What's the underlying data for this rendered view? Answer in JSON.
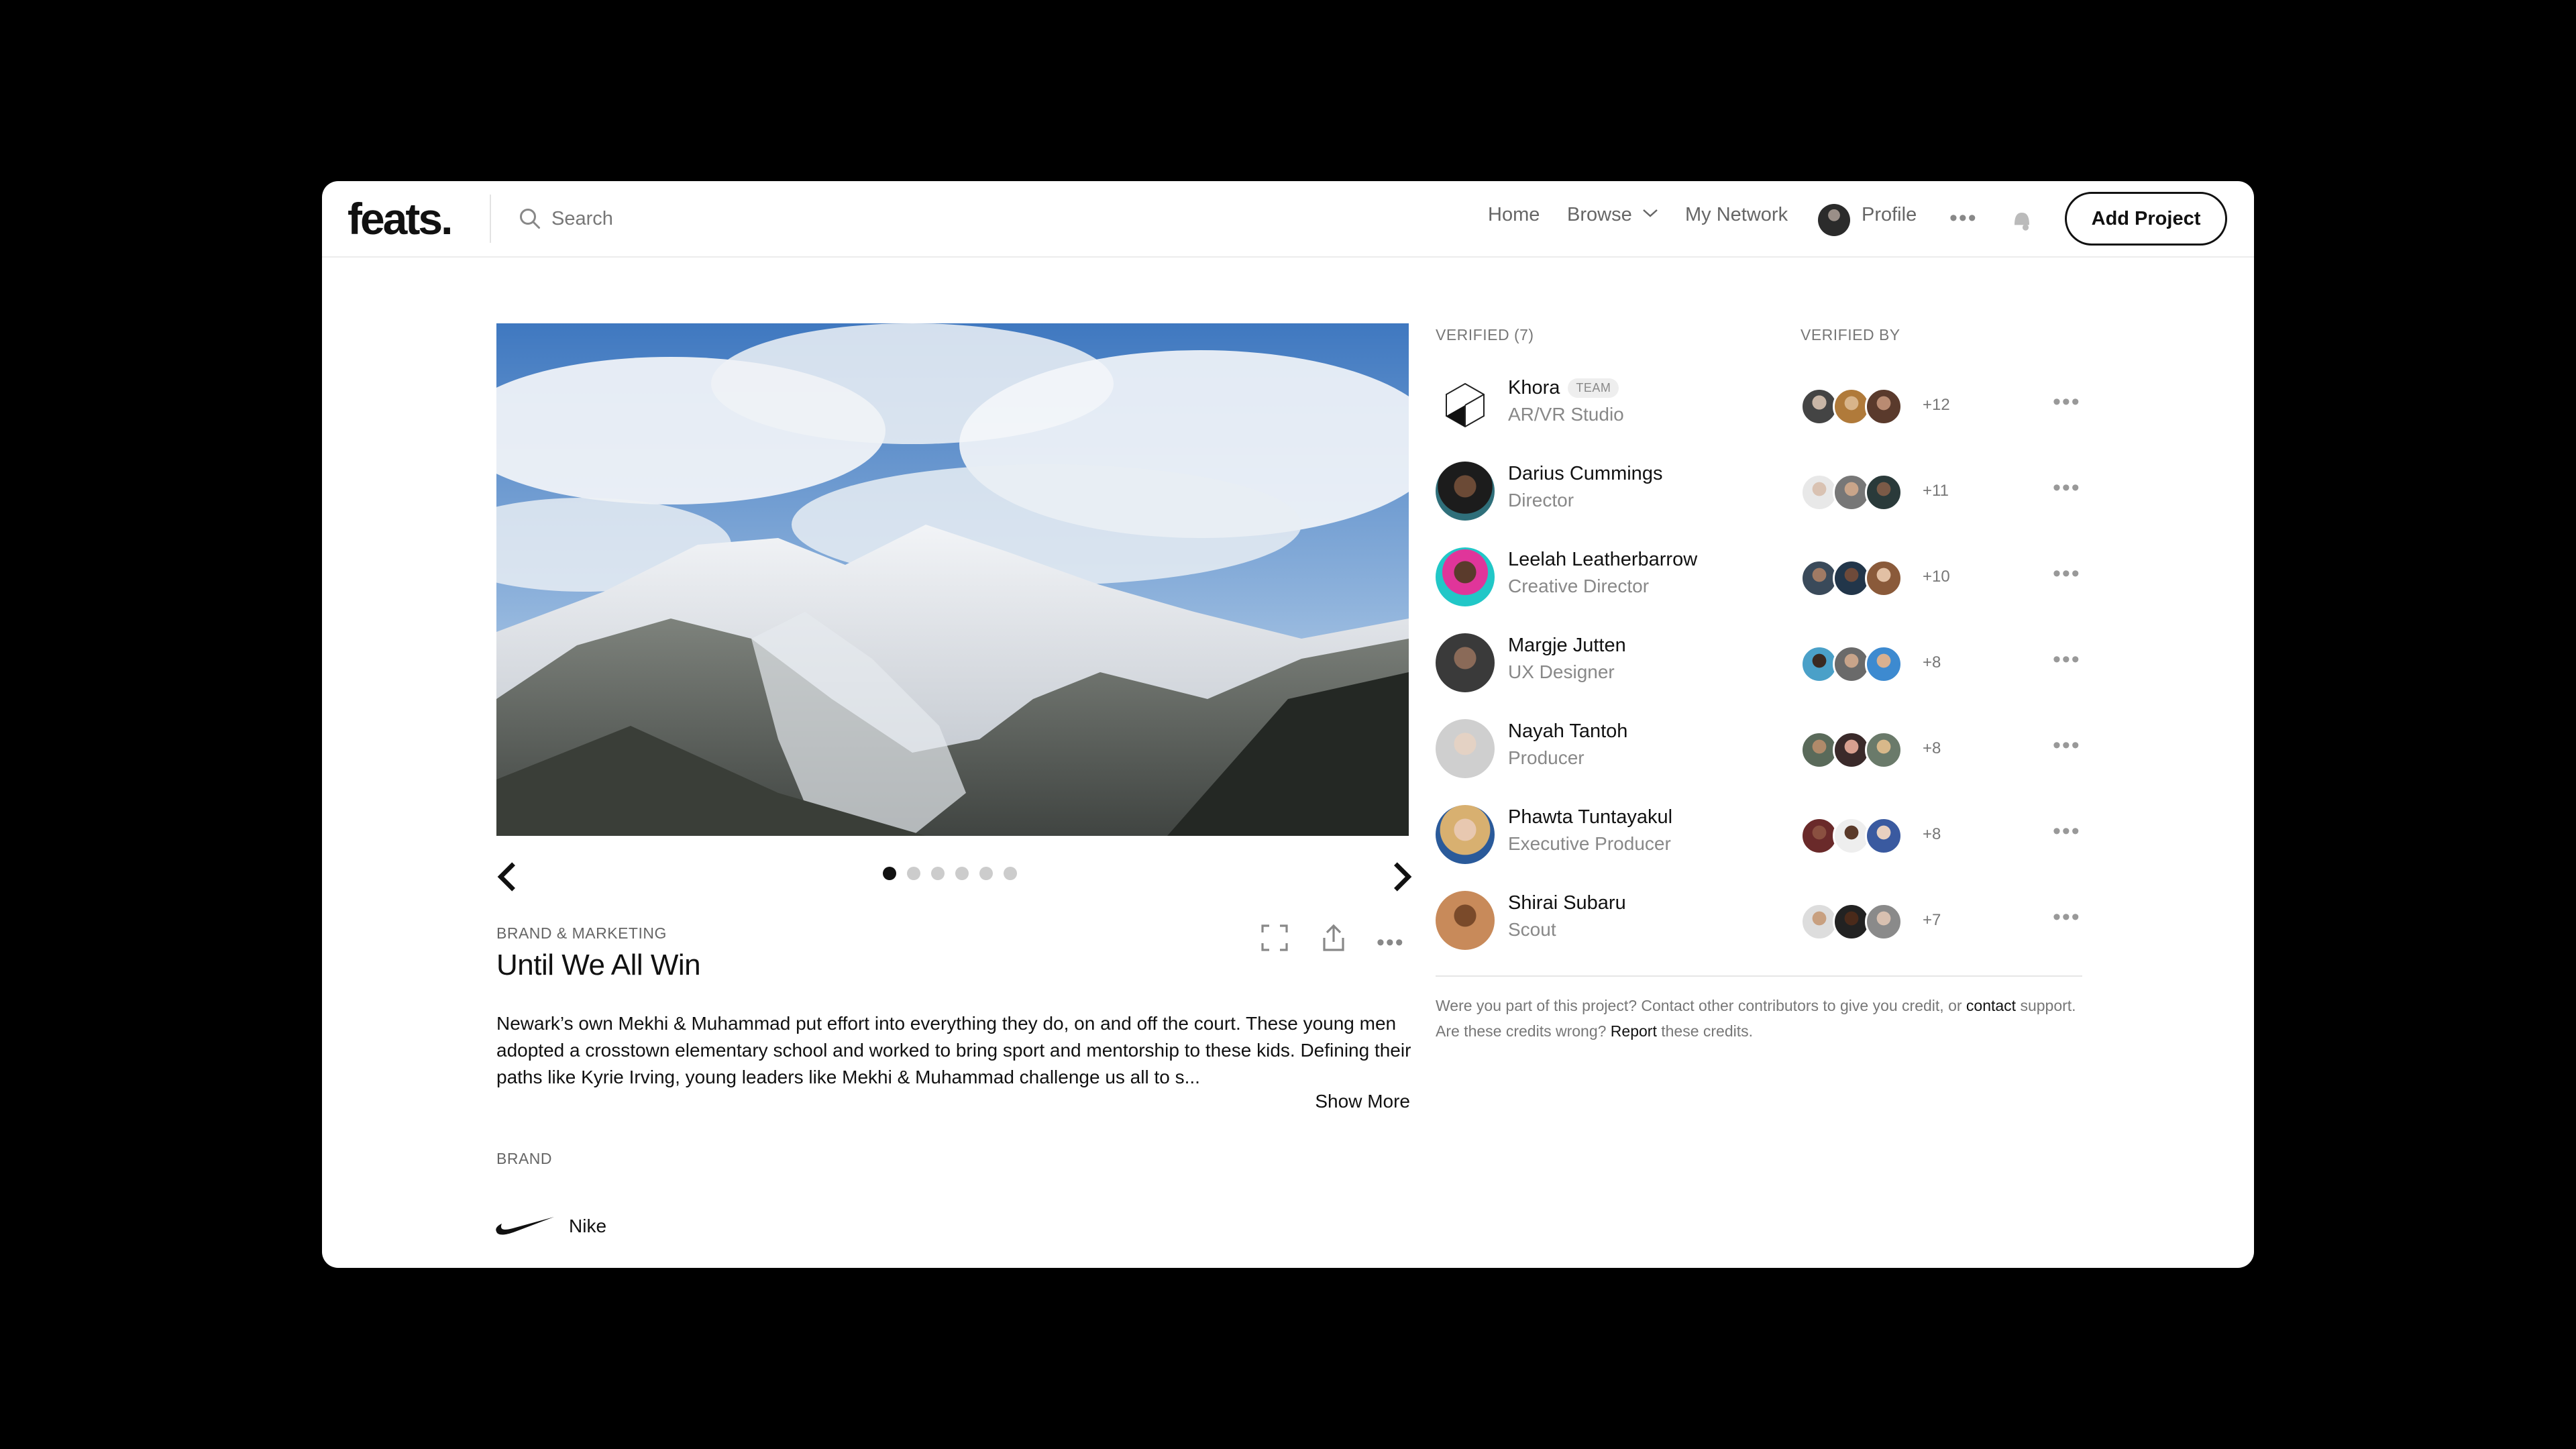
{
  "app": {
    "logo": "feats."
  },
  "search": {
    "placeholder": "Search"
  },
  "nav": {
    "home": "Home",
    "browse": "Browse",
    "network": "My Network",
    "profile": "Profile",
    "more": "•••",
    "add_project": "Add Project"
  },
  "project": {
    "category": "BRAND & MARKETING",
    "title": "Until We All Win",
    "description": "Newark’s own Mekhi & Muhammad put effort into everything they do, on and off the court. These young men adopted a crosstown elementary school and worked to bring sport and mentorship to these kids. Defining their paths like Kyrie Irving, young leaders like Mekhi & Muhammad challenge us all to s...",
    "show_more": "Show More",
    "brand_label": "BRAND",
    "brand_name": "Nike",
    "carousel": {
      "slides": 6,
      "active": 1
    },
    "more": "•••"
  },
  "verified": {
    "header": "VERIFIED (7)",
    "by_header": "VERIFIED BY",
    "team_badge": "TEAM",
    "rows": [
      {
        "name": "Khora",
        "role": "AR/VR Studio",
        "count": "+12",
        "team": true
      },
      {
        "name": "Darius Cummings",
        "role": "Director",
        "count": "+11"
      },
      {
        "name": "Leelah Leatherbarrow",
        "role": "Creative Director",
        "count": "+10"
      },
      {
        "name": "Margje Jutten",
        "role": "UX Designer",
        "count": "+8"
      },
      {
        "name": "Nayah Tantoh",
        "role": "Producer",
        "count": "+8"
      },
      {
        "name": "Phawta Tuntayakul",
        "role": "Executive Producer",
        "count": "+8"
      },
      {
        "name": "Shirai Subaru",
        "role": "Scout",
        "count": "+7"
      }
    ],
    "more": "•••"
  },
  "footnote": {
    "part1": "Were you part of this project? Contact other contributors to give you credit, or",
    "contact": "contact",
    "part2": "support. Are these credits wrong?",
    "report": "Report",
    "part3": "these credits."
  },
  "colors": {
    "accent": "#111111",
    "muted": "#777777",
    "divider": "#e6e6e6"
  }
}
